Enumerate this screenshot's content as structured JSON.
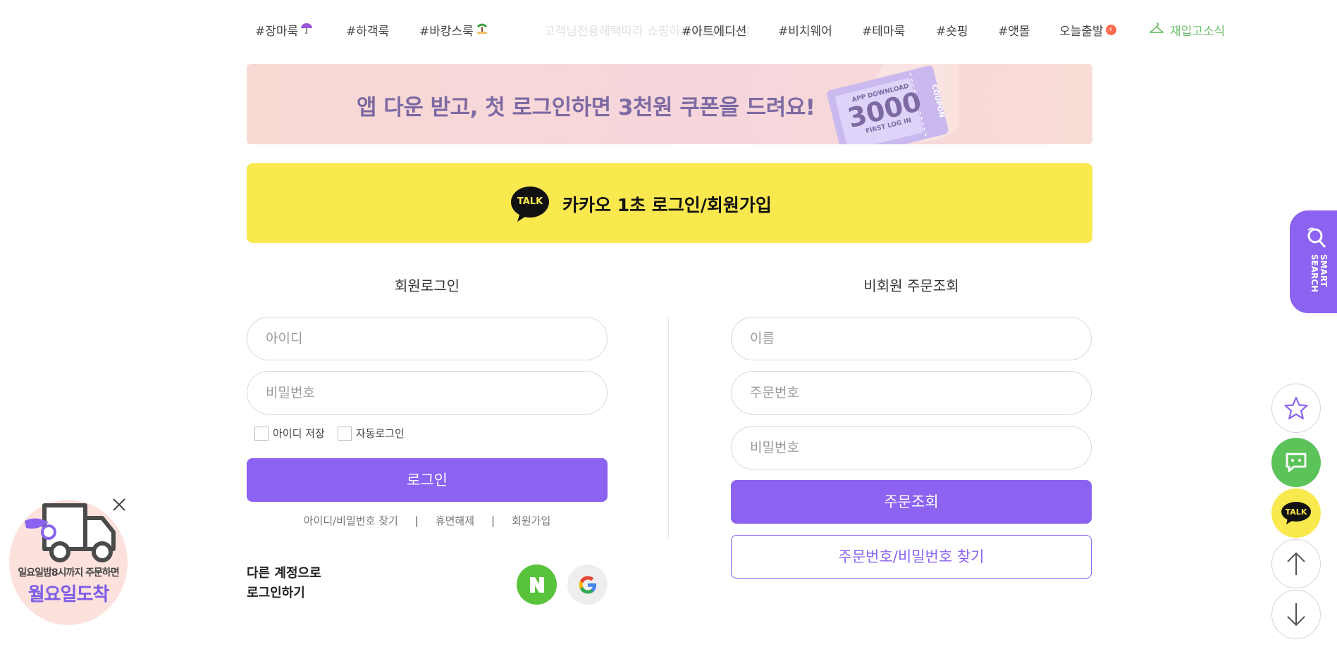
{
  "nav": {
    "tags": [
      "#장마룩",
      "#하객룩",
      "#바캉스룩",
      "#아트에디션",
      "#비치웨어",
      "#테마룩",
      "#숏핑",
      "#앳몰",
      "오늘출발"
    ],
    "faded_text": "고객님전용혜택따라 쇼핑하세요 알림소식",
    "restock": "재입고소식"
  },
  "banner": {
    "text": "앱 다운 받고, 첫 로그인하면 3천원 쿠폰을 드려요!",
    "coupon_line1": "APP DOWNLOAD",
    "coupon_amount": "3000",
    "coupon_line2": "FIRST LOG IN",
    "coupon_tag": "COUPON"
  },
  "kakao": {
    "badge": "TALK",
    "label": "카카오 1초 로그인/회원가입"
  },
  "member": {
    "title": "회원로그인",
    "id_placeholder": "아이디",
    "pw_placeholder": "비밀번호",
    "save_id": "아이디 저장",
    "auto_login": "자동로그인",
    "login_button": "로그인",
    "links": [
      "아이디/비밀번호 찾기",
      "휴면해제",
      "회원가입"
    ],
    "separator": "|",
    "other_login_line1": "다른 계정으로",
    "other_login_line2": "로그인하기"
  },
  "guest": {
    "title": "비회원 주문조회",
    "name_placeholder": "이름",
    "order_placeholder": "주문번호",
    "pw_placeholder": "비밀번호",
    "lookup_button": "주문조회",
    "find_button": "주문번호/비밀번호 찾기"
  },
  "smart_search": {
    "line1": "SMART",
    "line2": "SEARCH"
  },
  "side": {
    "talk": "TALK"
  },
  "delivery": {
    "small": "일요일밤8시까지 주문하면",
    "big": "월요일도착"
  },
  "colors": {
    "accent": "#8b63f0",
    "kakao": "#fae84f",
    "naver": "#5ac33c",
    "restock": "#6cbf6b"
  },
  "icons": [
    "umbrella-icon",
    "palm-icon",
    "bolt-icon",
    "hanger-icon",
    "star-icon",
    "chat-icon",
    "arrow-up-icon",
    "arrow-down-icon",
    "truck-icon",
    "close-icon"
  ]
}
